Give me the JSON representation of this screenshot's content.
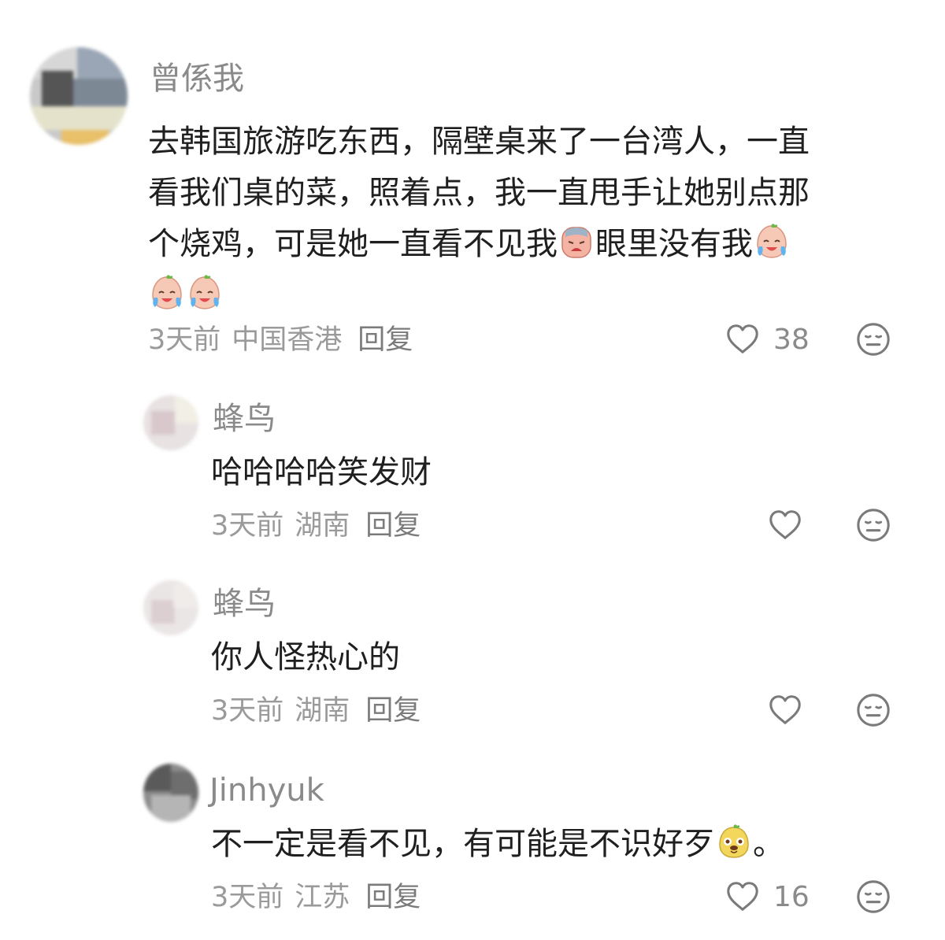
{
  "comments": [
    {
      "username": "曾係我",
      "text_lines": [
        "去韩国旅游吃东西，隔壁桌来了一台湾人，一直",
        "看我们桌的菜，照着点，我一直甩手让她别点那",
        "个烧鸡，可是她一直看不见我",
        "眼里没有我"
      ],
      "time": "3天前",
      "location": "中国香港",
      "reply_label": "回复",
      "likes": "38"
    },
    {
      "username": "蜂鸟",
      "text": "哈哈哈哈笑发财",
      "time": "3天前",
      "location": "湖南",
      "reply_label": "回复"
    },
    {
      "username": "蜂鸟",
      "text": "你人怪热心的",
      "time": "3天前",
      "location": "湖南",
      "reply_label": "回复"
    },
    {
      "username": "Jinhyuk",
      "text": "不一定是看不见，有可能是不识好歹",
      "text_suffix": "。",
      "time": "3天前",
      "location": "江苏",
      "reply_label": "回复",
      "likes": "16"
    }
  ],
  "icons": {
    "like": "heart-outline-icon",
    "dislike": "neutral-face-icon",
    "emoji_crying": "crying-emoji-icon",
    "emoji_sad": "sad-emoji-icon",
    "emoji_dog": "dog-smile-emoji-icon"
  },
  "colors": {
    "username": "#8a8a8a",
    "meta": "#9a9a9a",
    "text": "#1f1f1f",
    "icon": "#7a7a7a"
  }
}
